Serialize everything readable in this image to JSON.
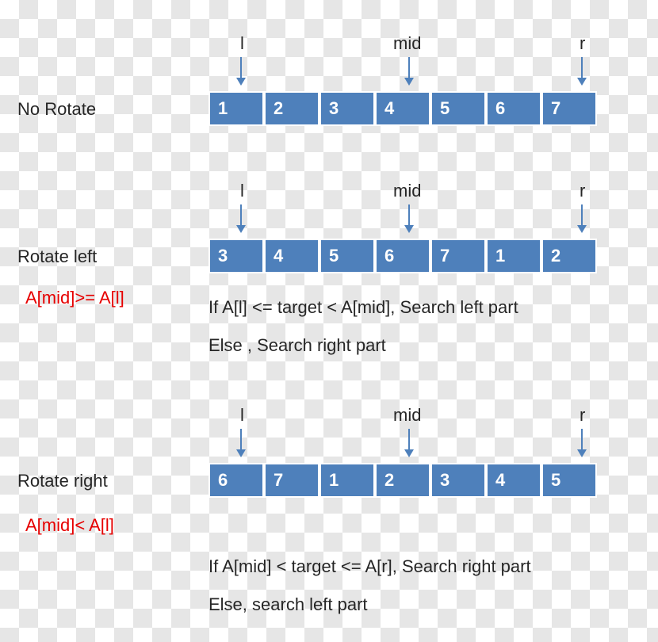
{
  "colors": {
    "cell_fill": "#4e80bb",
    "cell_border": "#ffffff",
    "cell_text": "#ffffff",
    "cond_text": "#e60000",
    "arrow": "#4e80bb"
  },
  "pointers": {
    "l": "l",
    "mid": "mid",
    "r": "r"
  },
  "sections": {
    "no_rotate": {
      "title": "No Rotate",
      "cells": [
        "1",
        "2",
        "3",
        "4",
        "5",
        "6",
        "7"
      ]
    },
    "rotate_left": {
      "title": "Rotate left",
      "condition": "A[mid]>= A[l]",
      "cells": [
        "3",
        "4",
        "5",
        "6",
        "7",
        "1",
        "2"
      ],
      "rule_if": "If  A[l] <= target < A[mid], Search left part",
      "rule_else": "Else , Search right part"
    },
    "rotate_right": {
      "title": "Rotate right",
      "condition": "A[mid]< A[l]",
      "cells": [
        "6",
        "7",
        "1",
        "2",
        "3",
        "4",
        "5"
      ],
      "rule_if": "If  A[mid] < target <= A[r], Search right part",
      "rule_else": "Else, search left part"
    }
  }
}
